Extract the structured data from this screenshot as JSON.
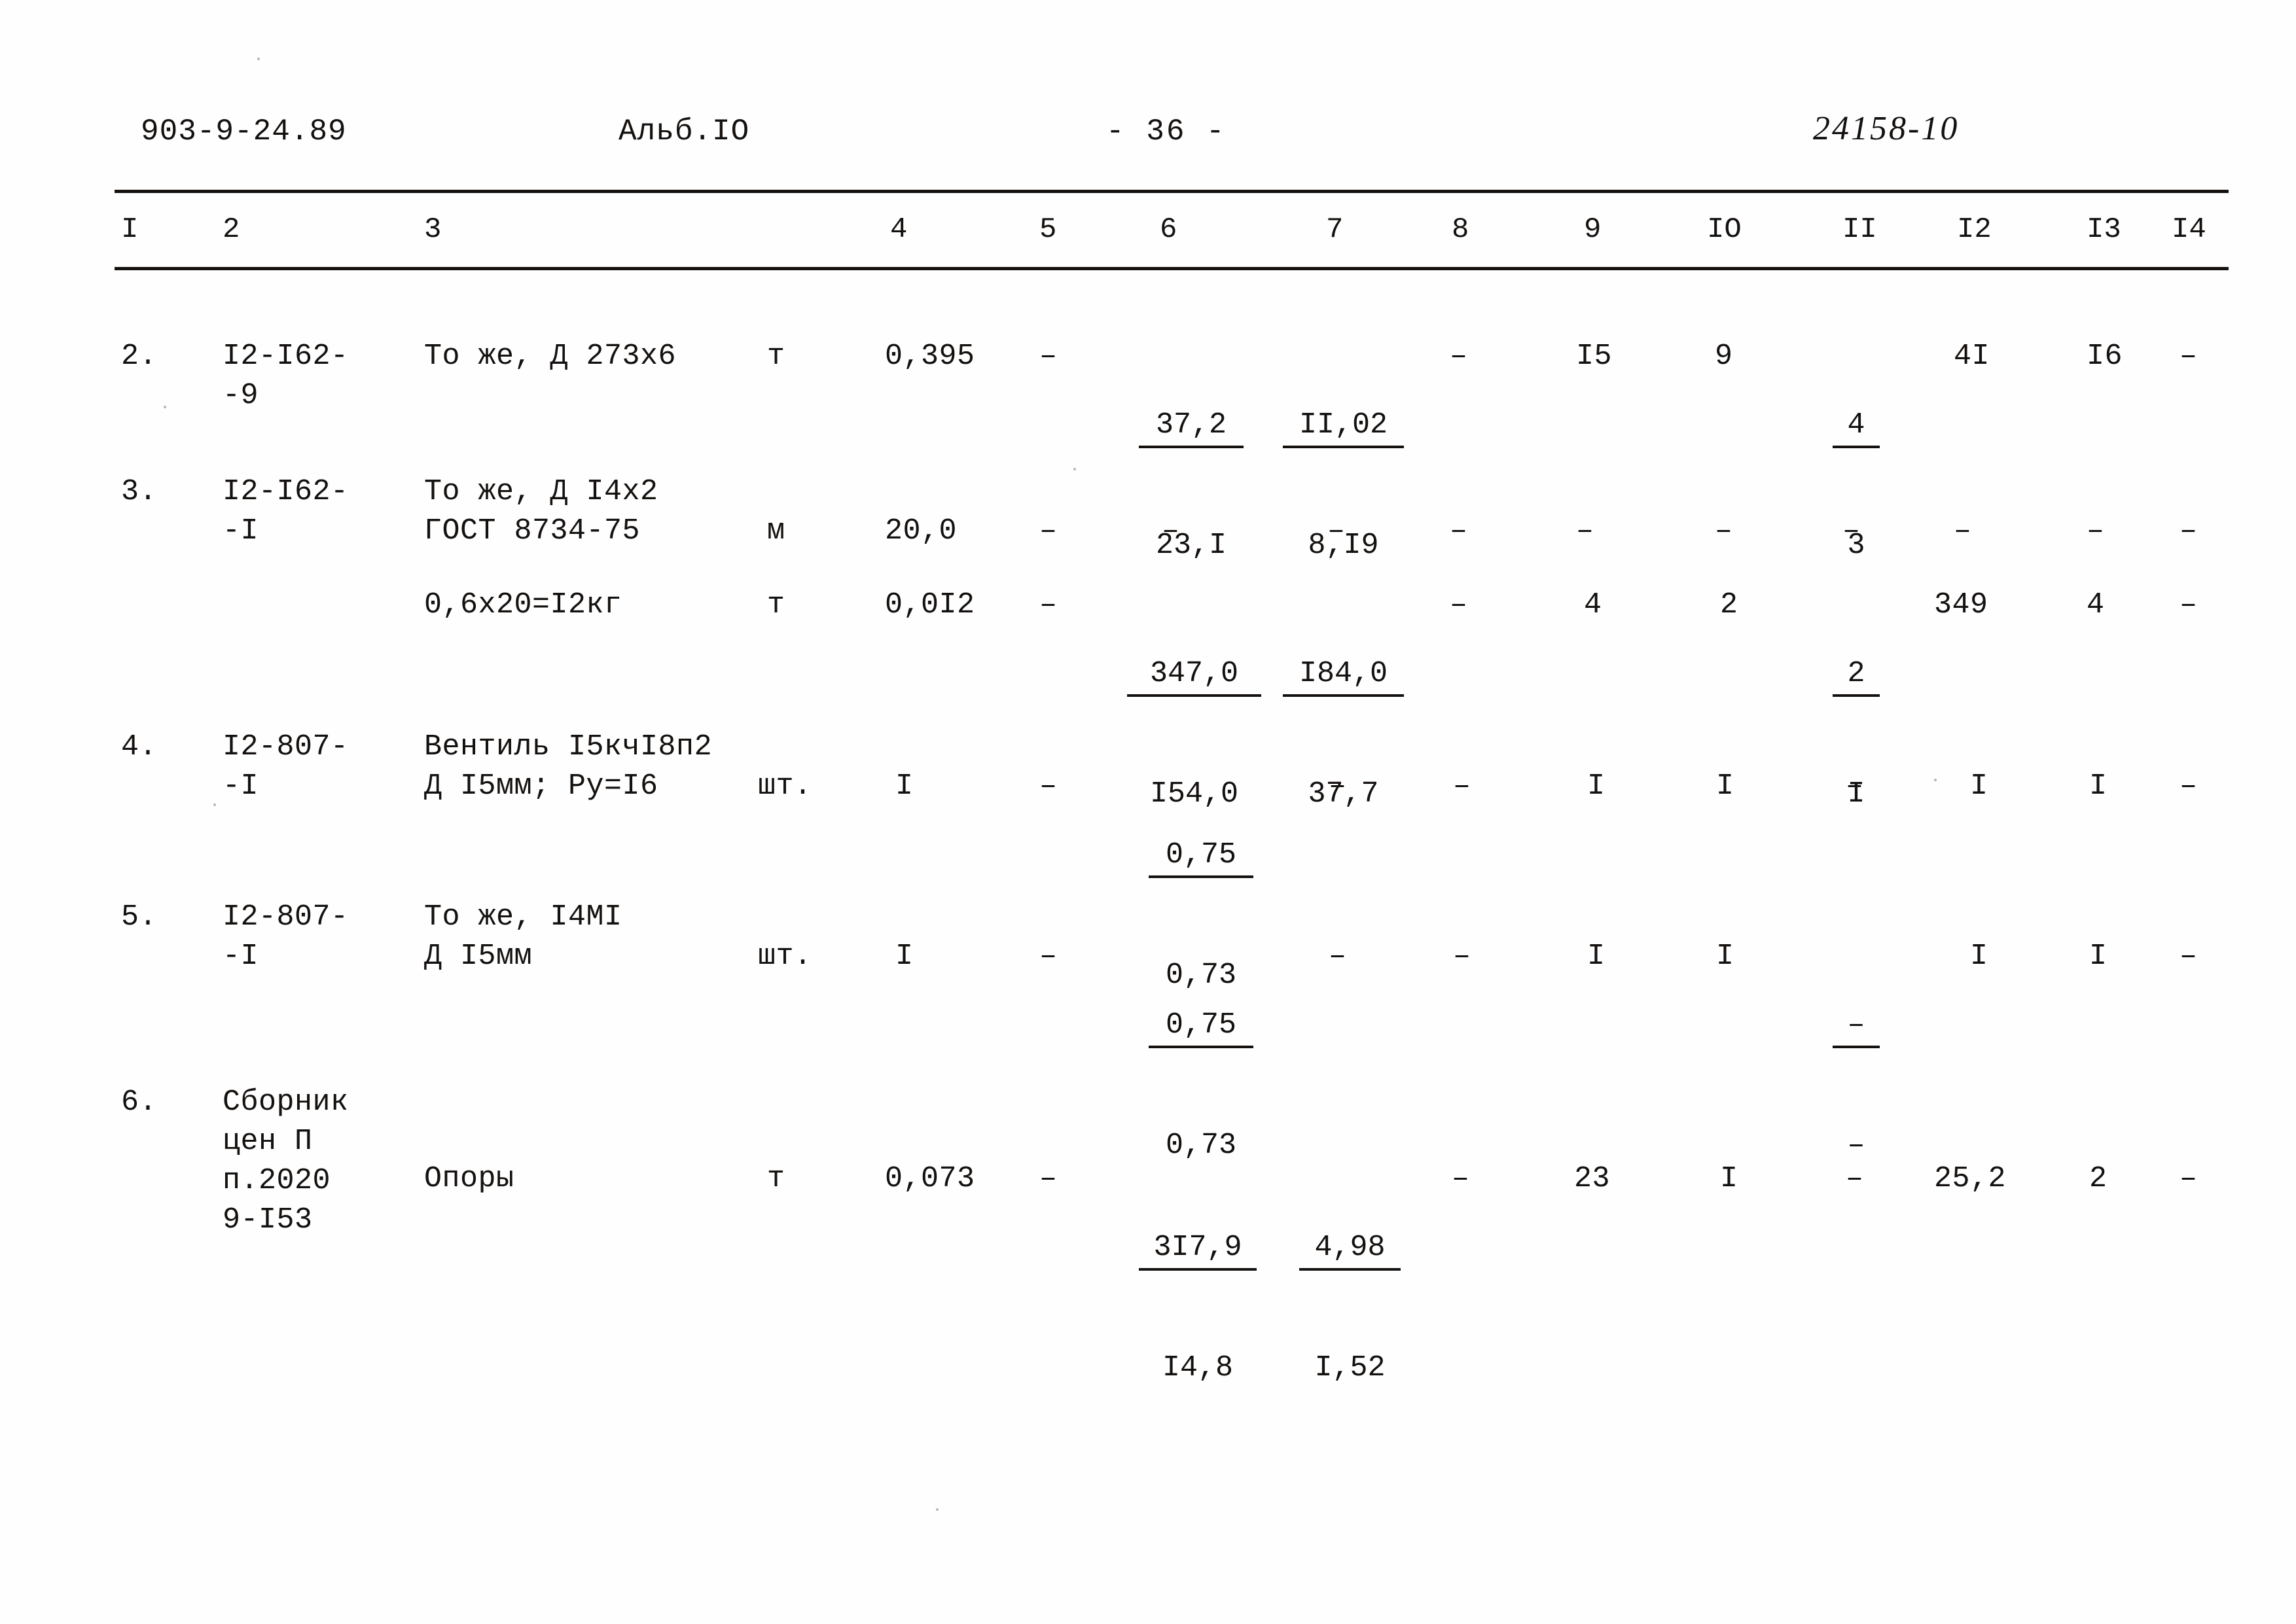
{
  "header": {
    "document_code": "903-9-24.89",
    "album": "Альб.IО",
    "page_marker": "- 36 -",
    "stamp": "24158-10"
  },
  "table": {
    "column_headers": [
      "I",
      "2",
      "3",
      "4",
      "5",
      "6",
      "7",
      "8",
      "9",
      "IO",
      "II",
      "I2",
      "I3",
      "I4"
    ],
    "rows": [
      {
        "no": "2.",
        "code": "I2-I62-\n-9",
        "name": "То же, Д 273х6",
        "unit": "т",
        "c4": "0,395",
        "c5": "–",
        "c6": {
          "top": "37,2",
          "bottom": "23,I"
        },
        "c7": {
          "top": "II,02",
          "bottom": "8,I9"
        },
        "c8": "–",
        "c9": "I5",
        "c10": "9",
        "c11": {
          "top": "4",
          "bottom": "3"
        },
        "c12": "4I",
        "c13": "I6",
        "c14": "–"
      },
      {
        "no": "3.",
        "code": "I2-I62-\n-I",
        "name": "То же, Д I4х2\nГОСТ 8734-75",
        "unit": "м",
        "c4": "20,0",
        "c5": "–",
        "c6": "–",
        "c7": "–",
        "c8": "–",
        "c9": "–",
        "c10": "–",
        "c11": "–",
        "c12": "–",
        "c13": "–",
        "c14": "–",
        "sub": {
          "name": "0,6х20=I2кг",
          "unit": "т",
          "c4": "0,0I2",
          "c5": "–",
          "c6": {
            "top": "347,0",
            "bottom": "I54,0"
          },
          "c7": {
            "top": "I84,0",
            "bottom": "37,7"
          },
          "c8": "–",
          "c9": "4",
          "c10": "2",
          "c11": {
            "top": "2",
            "bottom": "I"
          },
          "c12": "349",
          "c13": "4",
          "c14": "–"
        }
      },
      {
        "no": "4.",
        "code": "I2-807-\n-I",
        "name": "Вентиль I5кчI8п2\nД I5мм; Ру=I6",
        "unit": "шт.",
        "c4": "I",
        "c5": "–",
        "c6": {
          "top": "0,75",
          "bottom": "0,73"
        },
        "c7": "–",
        "c8": "–",
        "c9": "I",
        "c10": "I",
        "c11": "–",
        "c12": "I",
        "c13": "I",
        "c14": "–"
      },
      {
        "no": "5.",
        "code": "I2-807-\n-I",
        "name": "То же, I4MI\nД I5мм",
        "unit": "шт.",
        "c4": "I",
        "c5": "–",
        "c6": {
          "top": "0,75",
          "bottom": "0,73"
        },
        "c7": "–",
        "c8": "–",
        "c9": "I",
        "c10": "I",
        "c11": {
          "top": "–",
          "bottom": "–"
        },
        "c12": "I",
        "c13": "I",
        "c14": "–"
      },
      {
        "no": "6.",
        "code": "Сборник\nцен П\nп.2020\n9-I53",
        "name": "Опоры",
        "unit": "т",
        "c4": "0,073",
        "c5": "–",
        "c6": {
          "top": "3I7,9",
          "bottom": "I4,8"
        },
        "c7": {
          "top": "4,98",
          "bottom": "I,52"
        },
        "c8": "–",
        "c9": "23",
        "c10": "I",
        "c11": "–",
        "c12": "25,2",
        "c13": "2",
        "c14": "–"
      }
    ]
  }
}
